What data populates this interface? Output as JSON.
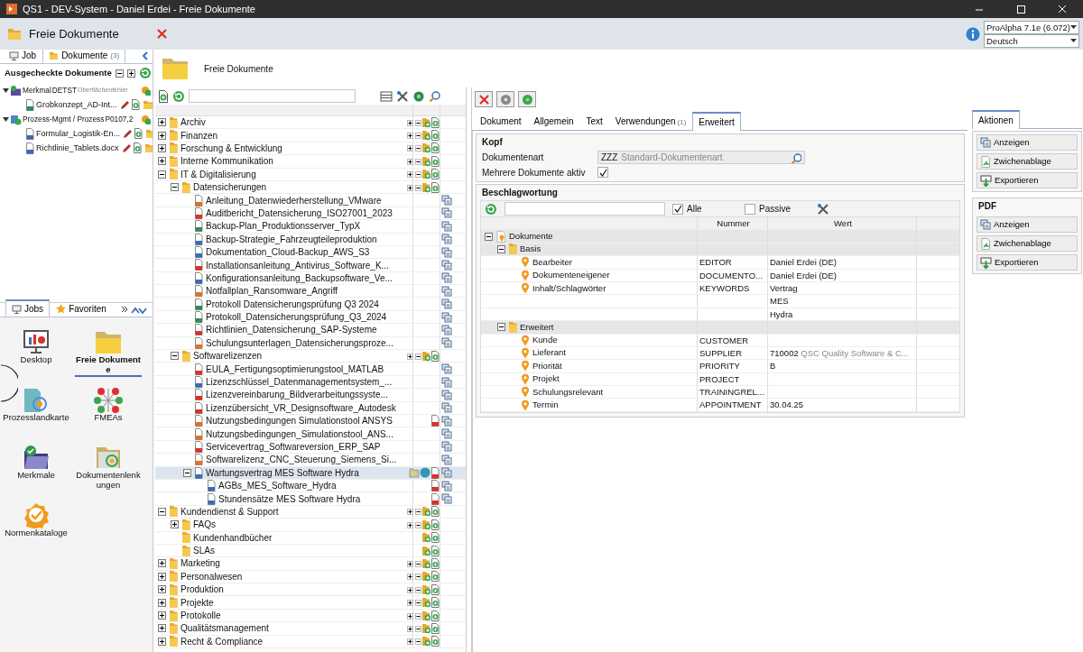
{
  "window": {
    "title": "QS1 - DEV-System - Daniel Erdei - Freie Dokumente"
  },
  "header": {
    "title": "Freie Dokumente",
    "version_select": "ProAlpha 7.1e (6.072)",
    "language_select": "Deutsch"
  },
  "left_panel": {
    "tabs": [
      {
        "label": "Job",
        "selected": false
      },
      {
        "label": "Dokumente",
        "count": "(3)",
        "selected": true
      }
    ],
    "checked_out": {
      "title": "Ausgecheckte Dokumente",
      "items": [
        {
          "kind": "merkmal",
          "label": "Merkmal",
          "code": "DETST",
          "note": "Oberflächenfehler",
          "expanded": true,
          "children": [
            {
              "label": "Grobkonzept_AD-Int...",
              "color": "#2e8b57"
            }
          ]
        },
        {
          "kind": "prozess",
          "label": "Prozess-Mgmt / Prozess",
          "code": "P0107,2",
          "expanded": true,
          "children": [
            {
              "label": "Formular_Logistik-En...",
              "color": "#3b6db3"
            },
            {
              "label": "Richtlinie_Tablets.docx",
              "color": "#3b6db3"
            }
          ]
        }
      ]
    }
  },
  "jobs_panel": {
    "tabs": [
      {
        "label": "Jobs",
        "selected": true
      },
      {
        "label": "Favoriten",
        "selected": false
      }
    ],
    "items": [
      {
        "kind": "desktop",
        "label": "Desktop",
        "selected": false
      },
      {
        "kind": "folder",
        "label": "Freie Dokumente",
        "selected": true
      },
      {
        "kind": "map",
        "label": "Prozesslandkarte",
        "selected": false
      },
      {
        "kind": "fmea",
        "label": "FMEAs",
        "selected": false
      },
      {
        "kind": "merkmal",
        "label": "Merkmale",
        "selected": false
      },
      {
        "kind": "lenkung",
        "label": "Dokumentenlenkungen",
        "selected": false
      },
      {
        "kind": "norm",
        "label": "Normenkataloge",
        "selected": false
      }
    ]
  },
  "main": {
    "title": "Freie Dokumente"
  },
  "document_tree": {
    "rows": [
      {
        "kind": "folder",
        "label": "Archiv",
        "expanded": false,
        "selected": false
      },
      {
        "kind": "folder",
        "label": "Finanzen",
        "expanded": false,
        "selected": false
      },
      {
        "kind": "folder",
        "label": "Forschung & Entwicklung",
        "expanded": false,
        "selected": false
      },
      {
        "kind": "folder",
        "label": "Interne Kommunikation",
        "expanded": false,
        "selected": false
      },
      {
        "kind": "folder",
        "label": "IT & Digitalisierung",
        "expanded": true,
        "selected": false,
        "children": [
          {
            "kind": "folder",
            "label": "Datensicherungen",
            "expanded": true,
            "selected": false,
            "children": [
              {
                "kind": "document",
                "label": "Anleitung_Datenwiederherstellung_VMware",
                "color": "#e0702a",
                "selected": false,
                "checked_out": false,
                "published": false,
                "pdf": false
              },
              {
                "kind": "document",
                "label": "Auditbericht_Datensicherung_ISO27001_2023",
                "color": "#d9312b",
                "selected": false,
                "checked_out": false,
                "published": false,
                "pdf": false
              },
              {
                "kind": "document",
                "label": "Backup-Plan_Produktionsserver_TypX",
                "color": "#2e8b57",
                "selected": false,
                "checked_out": false,
                "published": false,
                "pdf": false
              },
              {
                "kind": "document",
                "label": "Backup-Strategie_Fahrzeugteileproduktion",
                "color": "#3b6db3",
                "selected": false,
                "checked_out": false,
                "published": false,
                "pdf": false
              },
              {
                "kind": "document",
                "label": "Dokumentation_Cloud-Backup_AWS_S3",
                "color": "#3b6db3",
                "selected": false,
                "checked_out": false,
                "published": false,
                "pdf": false
              },
              {
                "kind": "document",
                "label": "Installationsanleitung_Antivirus_Software_K...",
                "color": "#d9312b",
                "selected": false,
                "checked_out": false,
                "published": false,
                "pdf": false
              },
              {
                "kind": "document",
                "label": "Konfigurationsanleitung_Backupsoftware_Ve...",
                "color": "#3b6db3",
                "selected": false,
                "checked_out": false,
                "published": false,
                "pdf": false
              },
              {
                "kind": "document",
                "label": "Notfallplan_Ransomware_Angriff",
                "color": "#e0702a",
                "selected": false,
                "checked_out": false,
                "published": false,
                "pdf": false
              },
              {
                "kind": "document",
                "label": "Protokoll Datensicherungsprüfung Q3 2024",
                "color": "#2e8b57",
                "selected": false,
                "checked_out": false,
                "published": false,
                "pdf": false
              },
              {
                "kind": "document",
                "label": "Protokoll_Datensicherungsprüfung_Q3_2024",
                "color": "#2e8b57",
                "selected": false,
                "checked_out": false,
                "published": false,
                "pdf": false
              },
              {
                "kind": "document",
                "label": "Richtlinien_Datensicherung_SAP-Systeme",
                "color": "#d9312b",
                "selected": false,
                "checked_out": false,
                "published": false,
                "pdf": false
              },
              {
                "kind": "document",
                "label": "Schulungsunterlagen_Datensicherungsproze...",
                "color": "#e0702a",
                "selected": false,
                "checked_out": false,
                "published": false,
                "pdf": false
              }
            ]
          },
          {
            "kind": "folder",
            "label": "Softwarelizenzen",
            "expanded": true,
            "selected": false,
            "children": [
              {
                "kind": "document",
                "label": "EULA_Fertigungsoptimierungstool_MATLAB",
                "color": "#d9312b",
                "selected": false,
                "checked_out": false,
                "published": false,
                "pdf": false
              },
              {
                "kind": "document",
                "label": "Lizenzschlüssel_Datenmanagementsystem_...",
                "color": "#3b6db3",
                "selected": false,
                "checked_out": false,
                "published": false,
                "pdf": false
              },
              {
                "kind": "document",
                "label": "Lizenzvereinbarung_Bildverarbeitungssyste...",
                "color": "#d9312b",
                "selected": false,
                "checked_out": false,
                "published": false,
                "pdf": false
              },
              {
                "kind": "document",
                "label": "Lizenzübersicht_VR_Designsoftware_Autodesk",
                "color": "#d9312b",
                "selected": false,
                "checked_out": false,
                "published": false,
                "pdf": false
              },
              {
                "kind": "document",
                "label": "Nutzungsbedingungen Simulationstool ANSYS",
                "color": "#e0702a",
                "selected": false,
                "checked_out": false,
                "published": false,
                "pdf": true
              },
              {
                "kind": "document",
                "label": "Nutzungsbedingungen_Simulationstool_ANS...",
                "color": "#e0702a",
                "selected": false,
                "checked_out": false,
                "published": false,
                "pdf": false
              },
              {
                "kind": "document",
                "label": "Servicevertrag_Softwareversion_ERP_SAP",
                "color": "#d9312b",
                "selected": false,
                "checked_out": false,
                "published": false,
                "pdf": false
              },
              {
                "kind": "document",
                "label": "Softwarelizenz_CNC_Steuerung_Siemens_Si...",
                "color": "#e0702a",
                "selected": false,
                "checked_out": false,
                "published": false,
                "pdf": false
              },
              {
                "kind": "document",
                "label": "Wartungsvertrag MES Software Hydra",
                "color": "#3b6db3",
                "expanded": true,
                "selected": true,
                "checked_out": true,
                "published": true,
                "pdf": true,
                "children": [
                  {
                    "kind": "document",
                    "label": "AGBs_MES_Software_Hydra",
                    "color": "#3b6db3",
                    "selected": false,
                    "checked_out": false,
                    "published": false,
                    "pdf": true
                  },
                  {
                    "kind": "document",
                    "label": "Stundensätze MES Software Hydra",
                    "color": "#3b6db3",
                    "selected": false,
                    "checked_out": false,
                    "published": false,
                    "pdf": true
                  }
                ]
              }
            ]
          }
        ]
      },
      {
        "kind": "folder",
        "label": "Kundendienst & Support",
        "expanded": true,
        "selected": false,
        "children": [
          {
            "kind": "folder",
            "label": "FAQs",
            "expanded": false,
            "selected": false
          },
          {
            "kind": "folder",
            "label": "Kundenhandbücher",
            "selected": false
          },
          {
            "kind": "folder",
            "label": "SLAs",
            "selected": false
          }
        ]
      },
      {
        "kind": "folder",
        "label": "Marketing",
        "expanded": false,
        "selected": false
      },
      {
        "kind": "folder",
        "label": "Personalwesen",
        "expanded": false,
        "selected": false
      },
      {
        "kind": "folder",
        "label": "Produktion",
        "expanded": false,
        "selected": false
      },
      {
        "kind": "folder",
        "label": "Projekte",
        "expanded": false,
        "selected": false
      },
      {
        "kind": "folder",
        "label": "Protokolle",
        "expanded": false,
        "selected": false
      },
      {
        "kind": "folder",
        "label": "Qualitätsmanagement",
        "expanded": false,
        "selected": false
      },
      {
        "kind": "folder",
        "label": "Recht & Compliance",
        "expanded": false,
        "selected": false
      }
    ]
  },
  "detail": {
    "tabs": [
      {
        "label": "Dokument",
        "selected": false
      },
      {
        "label": "Allgemein",
        "selected": false
      },
      {
        "label": "Text",
        "selected": false
      },
      {
        "label": "Verwendungen",
        "count": "(1)",
        "selected": false
      },
      {
        "label": "Erweitert",
        "selected": true
      }
    ],
    "kopf": {
      "title": "Kopf",
      "document_type": {
        "label": "Dokumentenart",
        "code": "ZZZ",
        "value": "Standard-Dokumentenart"
      },
      "multiple_active": {
        "label": "Mehrere Dokumente aktiv",
        "checked": true
      }
    },
    "keywords": {
      "title": "Beschlagwortung",
      "filters": [
        {
          "label": "Alle",
          "checked": true
        },
        {
          "label": "Passive",
          "checked": false
        }
      ],
      "columns": [
        "Nummer",
        "Wert"
      ],
      "rows": [
        {
          "label": "Dokumente",
          "expanded": true,
          "children": [
            {
              "label": "Basis",
              "expanded": true,
              "children": [
                {
                  "label": "Bearbeiter",
                  "number": "EDITOR",
                  "values": [
                    "Daniel Erdei (DE)"
                  ]
                },
                {
                  "label": "Dokumenteneigener",
                  "number": "DOCUMENTO...",
                  "values": [
                    "Daniel Erdei (DE)"
                  ]
                },
                {
                  "label": "Inhalt/Schlagwörter",
                  "number": "KEYWORDS",
                  "values": [
                    "Vertrag",
                    "MES",
                    "Hydra"
                  ]
                }
              ]
            },
            {
              "label": "Erweitert",
              "expanded": true,
              "children": [
                {
                  "label": "Kunde",
                  "number": "CUSTOMER"
                },
                {
                  "label": "Lieferant",
                  "number": "SUPPLIER",
                  "values": [
                    "710002"
                  ],
                  "value_note": "QSC Quality Software & C..."
                },
                {
                  "label": "Priorität",
                  "number": "PRIORITY",
                  "values": [
                    "B"
                  ]
                },
                {
                  "label": "Projekt",
                  "number": "PROJECT"
                },
                {
                  "label": "Schulungsrelevant",
                  "number": "TRAININGREL..."
                },
                {
                  "label": "Termin",
                  "number": "APPOINTMENT",
                  "values": [
                    "30.04.25"
                  ]
                }
              ]
            }
          ]
        }
      ]
    }
  },
  "actions": {
    "tab": {
      "label": "Aktionen",
      "selected": true
    },
    "groups": [
      {
        "buttons": [
          {
            "kind": "view",
            "label": "Anzeigen"
          },
          {
            "kind": "clipboard",
            "label": "Zwichenablage"
          },
          {
            "kind": "export",
            "label": "Exportieren"
          }
        ]
      },
      {
        "title": "PDF",
        "buttons": [
          {
            "kind": "view",
            "label": "Anzeigen"
          },
          {
            "kind": "clipboard",
            "label": "Zwichenablage"
          },
          {
            "kind": "export",
            "label": "Exportieren"
          }
        ]
      }
    ]
  }
}
